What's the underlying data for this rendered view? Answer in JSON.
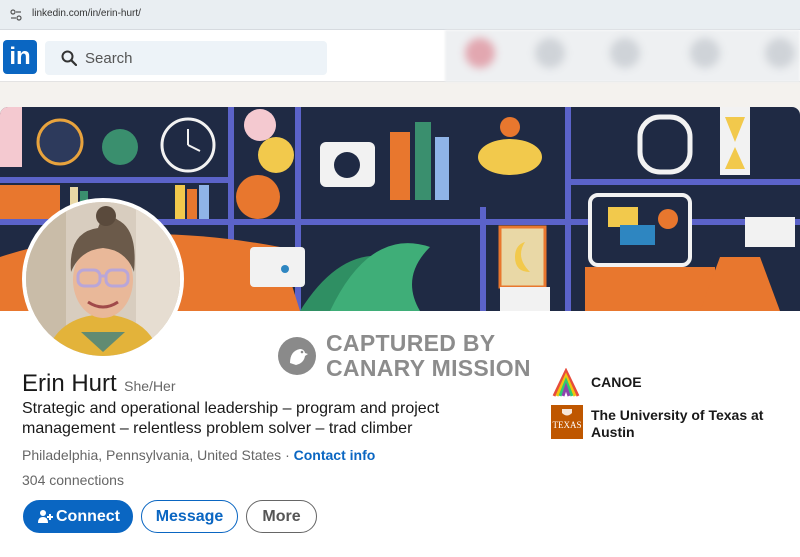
{
  "browser": {
    "url": "linkedin.com/in/erin-hurt/"
  },
  "navbar": {
    "logo_text": "in",
    "search_placeholder": "Search"
  },
  "watermark": {
    "line1": "CAPTURED BY",
    "line2": "CANARY MISSION"
  },
  "profile": {
    "name": "Erin Hurt",
    "pronouns": "She/Her",
    "headline": "Strategic and operational leadership – program and project management – relentless problem solver – trad climber",
    "location": "Philadelphia, Pennsylvania, United States",
    "location_separator": "·",
    "contact_info_label": "Contact info",
    "connections": "304 connections"
  },
  "actions": {
    "connect_label": "Connect",
    "message_label": "Message",
    "more_label": "More"
  },
  "organizations": [
    {
      "name": "CANOE"
    },
    {
      "name": "The University of Texas at Austin",
      "logo_text": "TEXAS"
    }
  ],
  "colors": {
    "brand": "#0a66c2",
    "ut_orange": "#bf5700"
  }
}
